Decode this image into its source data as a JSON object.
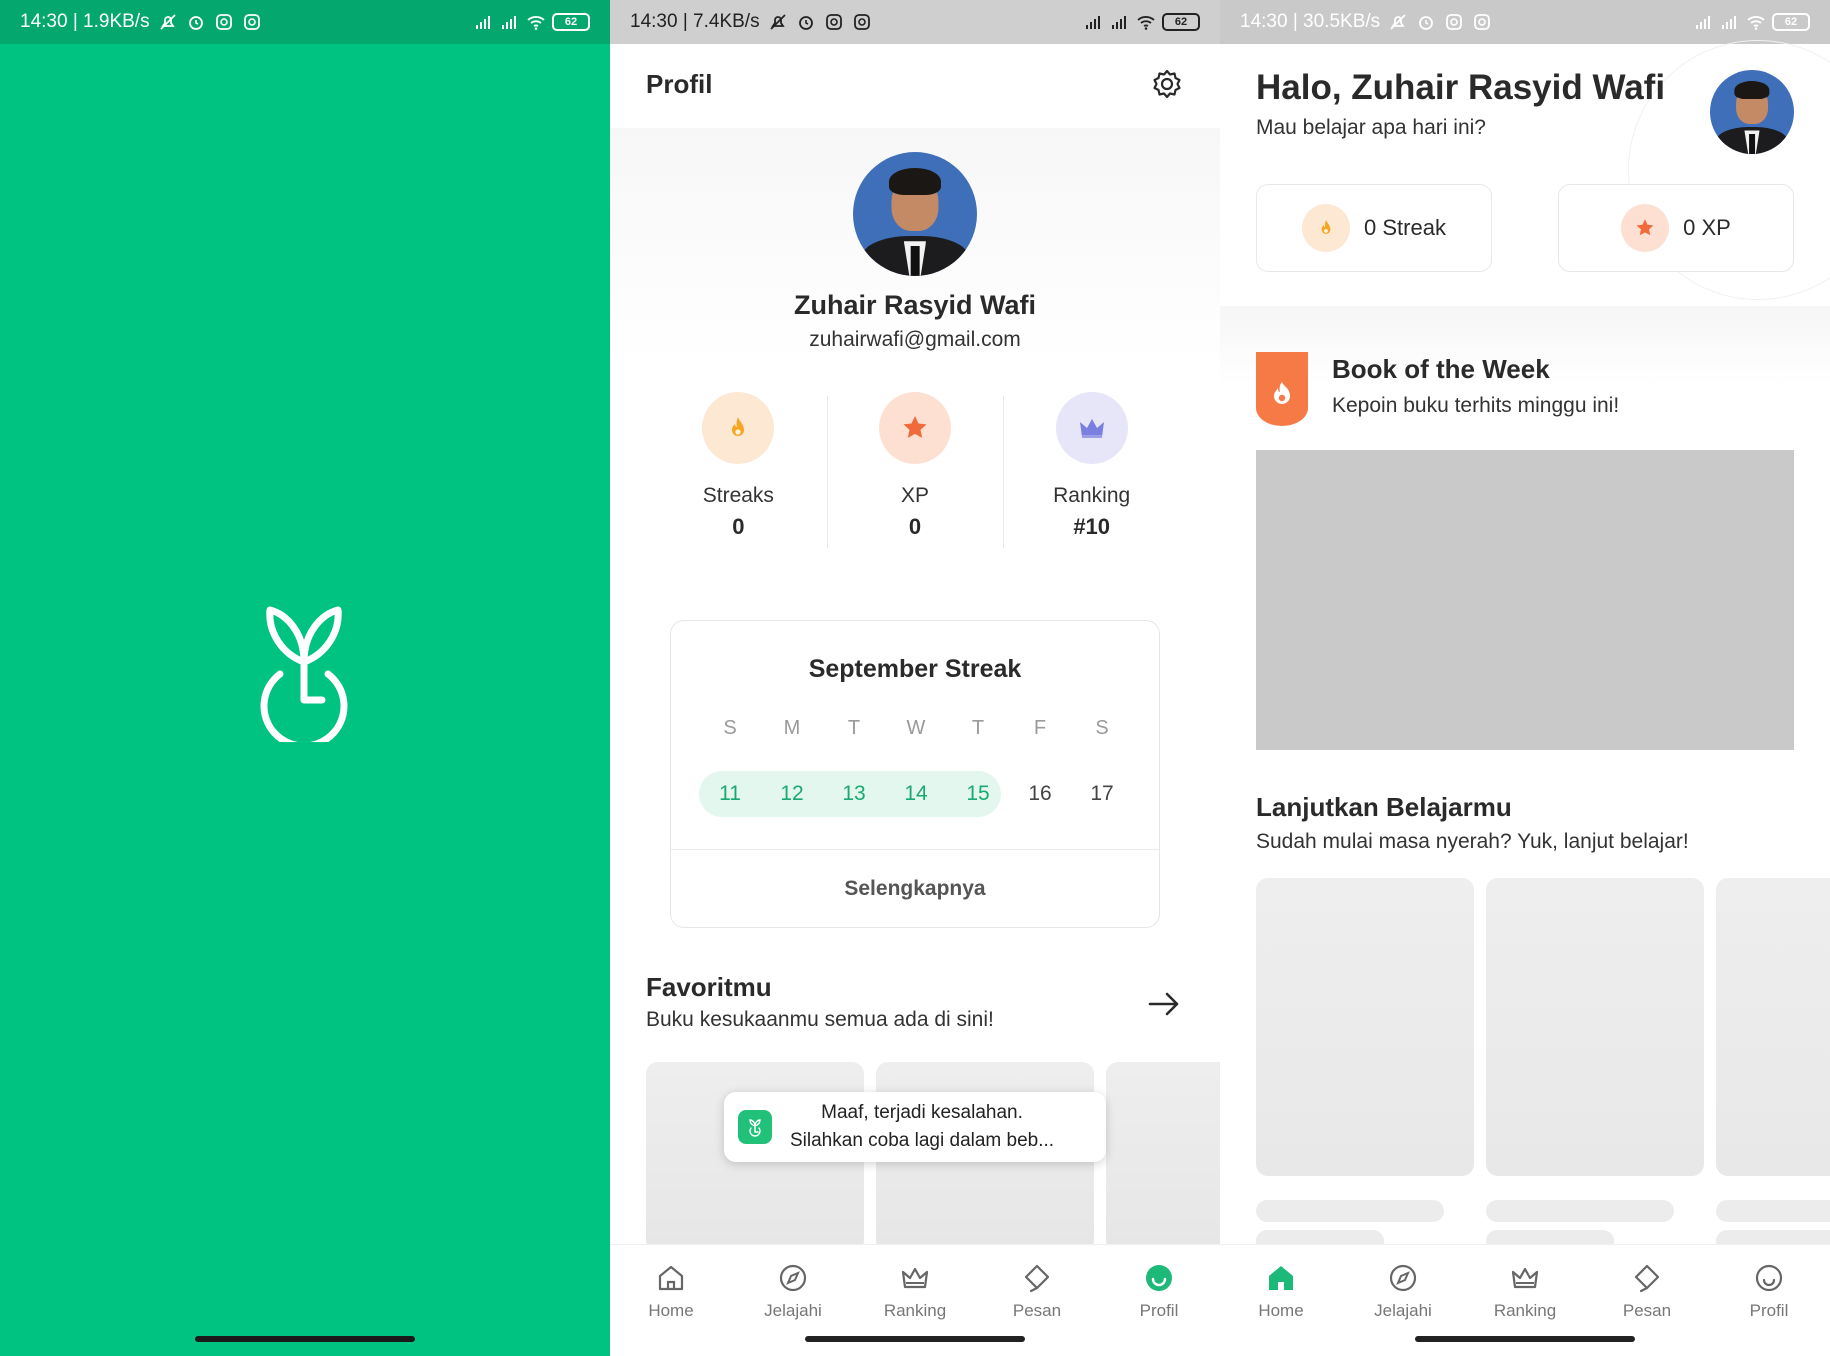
{
  "splash": {
    "status": {
      "time_speed": "14:30 | 1.9KB/s",
      "battery": "62"
    },
    "colors": {
      "background": "#00c281"
    },
    "logo_icon": "sprout-logo-icon"
  },
  "profile": {
    "status": {
      "time_speed": "14:30 | 7.4KB/s",
      "battery": "62"
    },
    "header": {
      "title": "Profil",
      "settings_icon": "gear-icon"
    },
    "user": {
      "name": "Zuhair Rasyid Wafi",
      "email": "zuhairwafi@gmail.com"
    },
    "stats": [
      {
        "label": "Streaks",
        "value": "0",
        "icon": "flame-icon",
        "color": "#f5a623"
      },
      {
        "label": "XP",
        "value": "0",
        "icon": "star-icon",
        "color": "#f06a3a"
      },
      {
        "label": "Ranking",
        "value": "#10",
        "icon": "crown-icon",
        "color": "#7b7fe0"
      }
    ],
    "streak_card": {
      "title": "September Streak",
      "weekdays": [
        "S",
        "M",
        "T",
        "W",
        "T",
        "F",
        "S"
      ],
      "dates": [
        "11",
        "12",
        "13",
        "14",
        "15",
        "16",
        "17"
      ],
      "active_dates": [
        "11",
        "12",
        "13",
        "14",
        "15"
      ],
      "more_label": "Selengkapnya"
    },
    "favorites": {
      "title": "Favoritmu",
      "subtitle": "Buku kesukaanmu semua ada di sini!"
    },
    "toast": {
      "line1": "Maaf, terjadi kesalahan.",
      "line2": "Silahkan coba lagi dalam beb..."
    },
    "nav_active": "Profil"
  },
  "home": {
    "status": {
      "time_speed": "14:30 | 30.5KB/s",
      "battery": "62"
    },
    "greeting": "Halo, Zuhair Rasyid Wafi",
    "subtitle": "Mau belajar apa hari ini?",
    "streak_text": "0 Streak",
    "xp_text": "0 XP",
    "book_of_week": {
      "title": "Book of the Week",
      "subtitle": "Kepoin buku terhits minggu ini!"
    },
    "continue": {
      "title": "Lanjutkan Belajarmu",
      "subtitle": "Sudah mulai masa nyerah? Yuk, lanjut belajar!"
    },
    "nav_active": "Home"
  },
  "nav": {
    "items": [
      {
        "label": "Home",
        "icon": "home-icon"
      },
      {
        "label": "Jelajahi",
        "icon": "compass-icon"
      },
      {
        "label": "Ranking",
        "icon": "crown-icon"
      },
      {
        "label": "Pesan",
        "icon": "message-icon"
      },
      {
        "label": "Profil",
        "icon": "smile-icon"
      }
    ]
  },
  "colors": {
    "brand_green": "#00c281",
    "active_green": "#1aa874",
    "streak_band": "#e3f7ee"
  }
}
